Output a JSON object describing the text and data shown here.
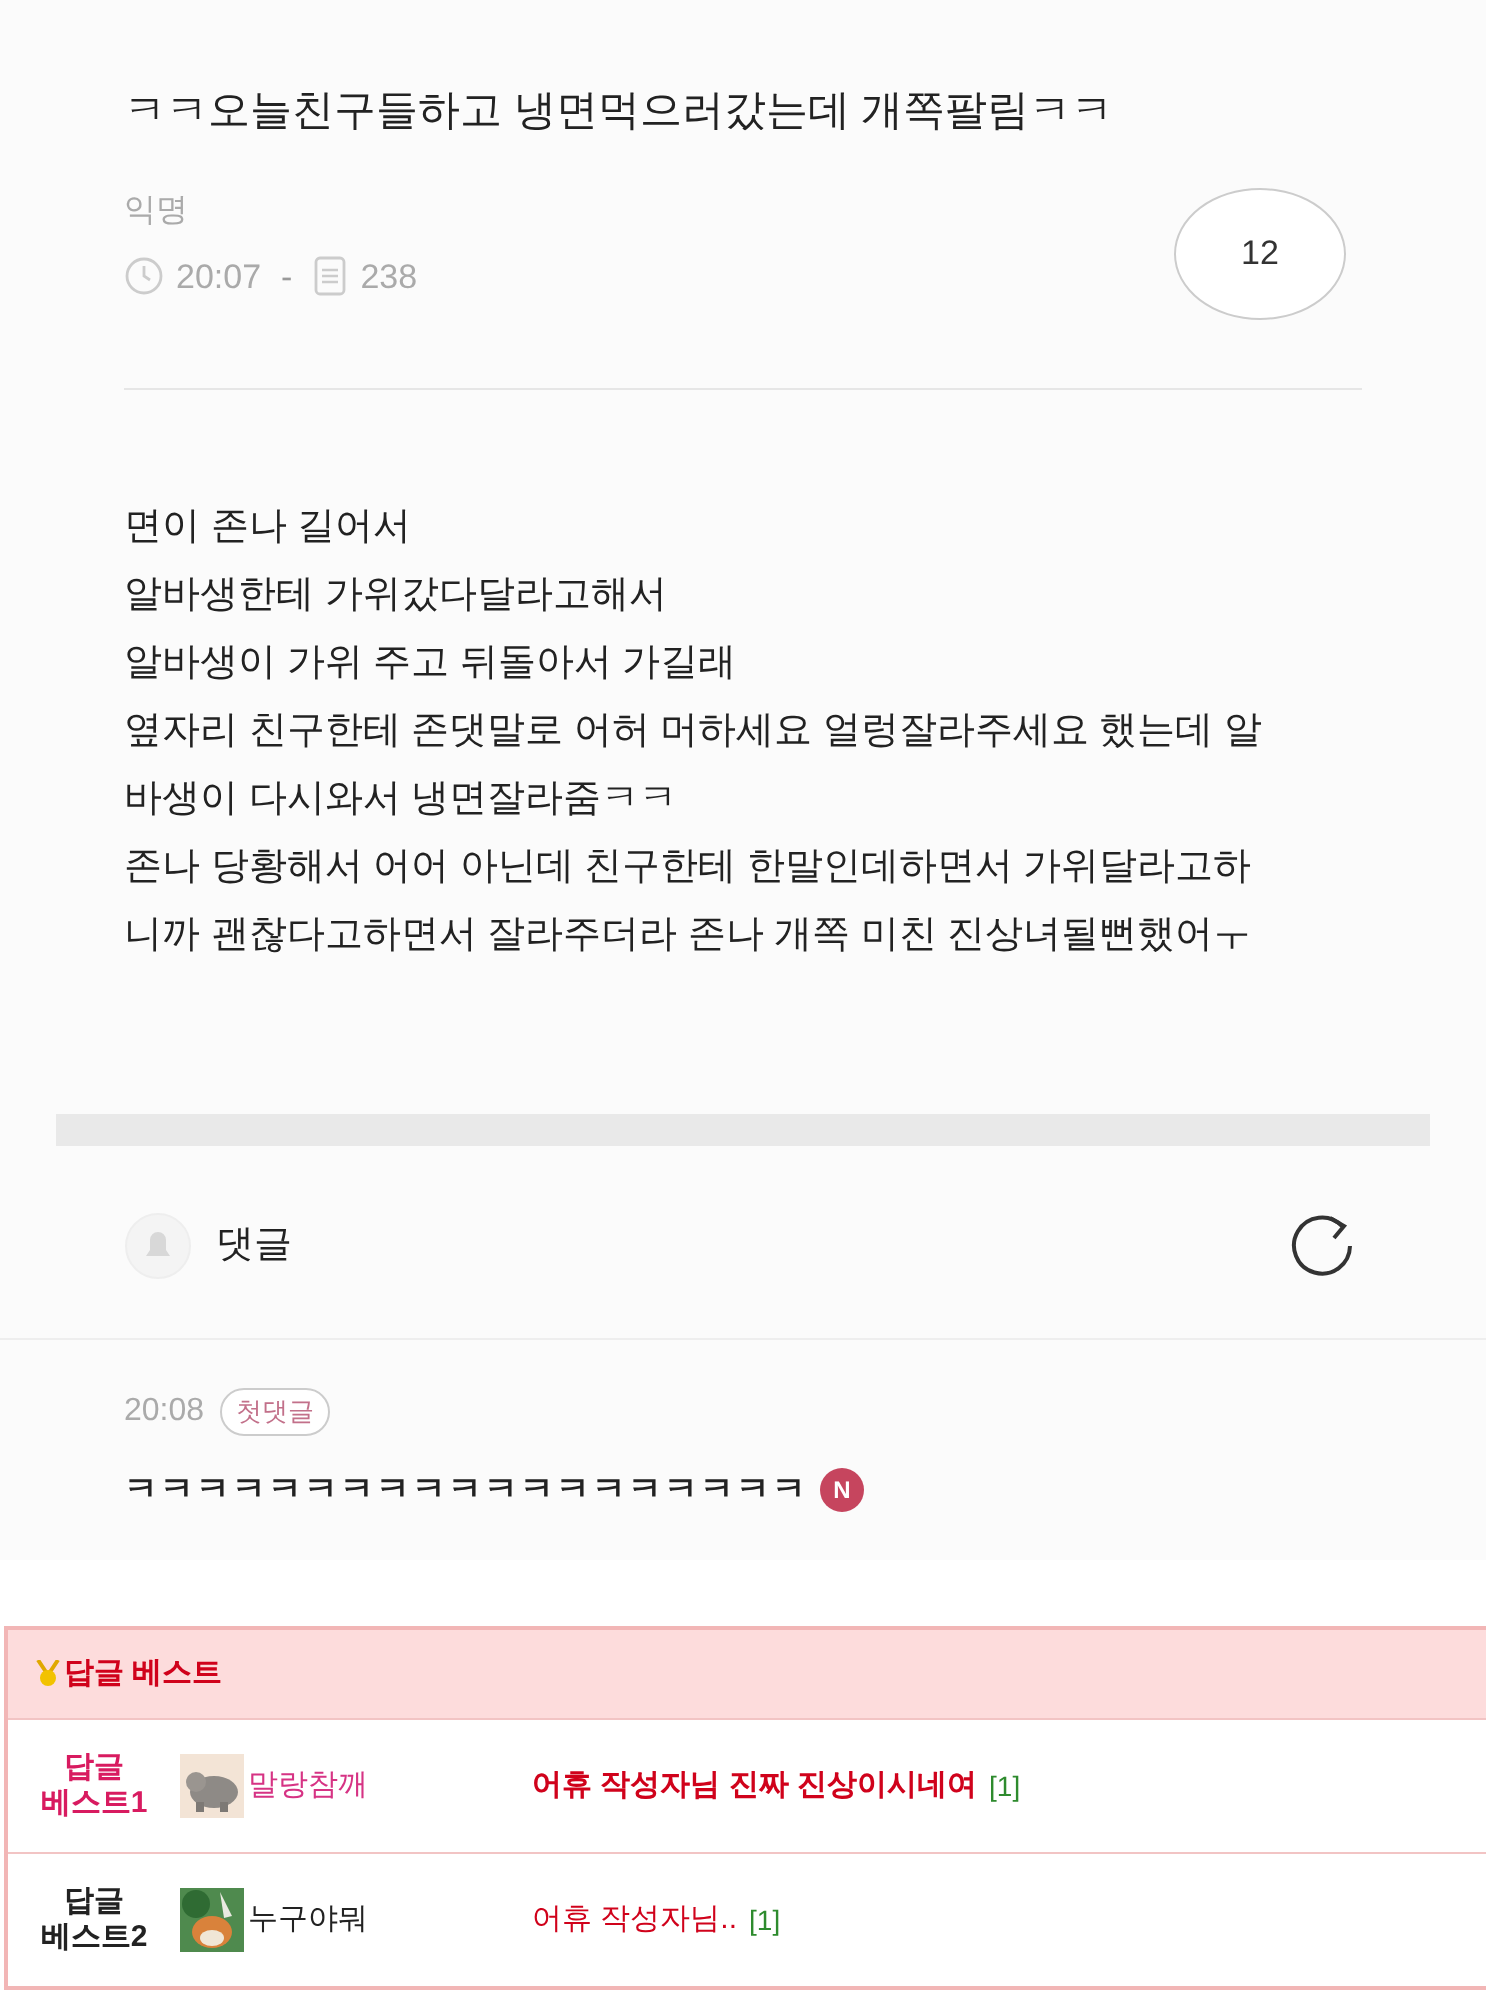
{
  "post": {
    "title": "ㅋㅋ오늘친구들하고 냉면먹으러갔는데 개쪽팔림ㅋㅋ",
    "author": "익명",
    "time": "20:07",
    "separator": "-",
    "views": "238",
    "comment_count": "12",
    "body": [
      "면이 존나 길어서",
      "알바생한테 가위갔다달라고해서",
      "알바생이 가위 주고 뒤돌아서 가길래",
      "옆자리 친구한테 존댓말로 어허 머하세요 얼렁잘라주세요 했는데 알",
      "바생이 다시와서 냉면잘라줌ㅋㅋ",
      "존나 당황해서 어어 아닌데 친구한테 한말인데하면서 가위달라고하",
      "니까 괜찮다고하면서 잘라주더라 존나 개쪽 미친 진상녀될뻔했어ㅜ"
    ]
  },
  "comments": {
    "heading": "댓글",
    "items": [
      {
        "time": "20:08",
        "badge": "첫댓글",
        "text": "ㅋㅋㅋㅋㅋㅋㅋㅋㅋㅋㅋㅋㅋㅋㅋㅋㅋㅋㅋ",
        "new_mark": "N"
      }
    ]
  },
  "best_replies": {
    "title": "답글 베스트",
    "rows": [
      {
        "rank": "답글 베스트1",
        "nickname": "말랑참깨",
        "text": "어휴 작성자님 진짜 진상이시네여",
        "count": "[1]",
        "highlighted": true
      },
      {
        "rank": "답글 베스트2",
        "nickname": "누구야뭐",
        "text": "어휴 작성자님..",
        "count": "[1]",
        "highlighted": false
      }
    ]
  }
}
